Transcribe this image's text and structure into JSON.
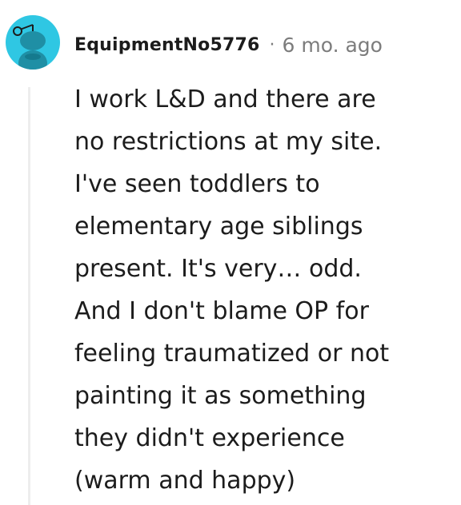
{
  "comment": {
    "username": "EquipmentNo5776",
    "separator": "·",
    "timestamp": "6 mo. ago",
    "avatar_icon": "reddit-snoo-avatar-icon",
    "accent_color": "#2fc7e3",
    "body_lines": [
      "I work L&D and there are",
      "no restrictions at my site.",
      "I've seen toddlers to",
      "elementary age siblings",
      "present. It's very… odd.",
      "And I don't blame OP for",
      "feeling traumatized or not",
      "painting it as something",
      "they didn't experience",
      "(warm and happy)"
    ]
  }
}
